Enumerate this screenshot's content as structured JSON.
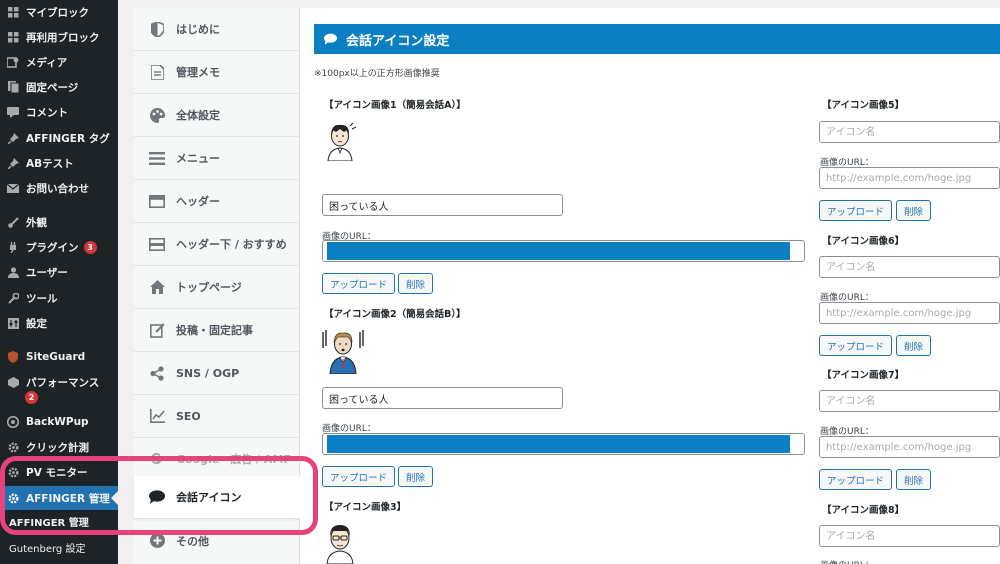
{
  "wp_sidebar": {
    "items": [
      {
        "label": "マイブロック",
        "icon": "grid-icon"
      },
      {
        "label": "再利用ブロック",
        "icon": "grid-icon"
      },
      {
        "label": "メディア",
        "icon": "media-icon"
      },
      {
        "label": "固定ページ",
        "icon": "page-icon"
      },
      {
        "label": "コメント",
        "icon": "comment-icon"
      },
      {
        "label": "AFFINGER タグ",
        "icon": "pin-icon"
      },
      {
        "label": "ABテスト",
        "icon": "pin-icon"
      },
      {
        "label": "お問い合わせ",
        "icon": "mail-icon"
      },
      {
        "label": "外観",
        "icon": "brush-icon"
      },
      {
        "label": "プラグイン",
        "icon": "plugin-icon",
        "badge": "3"
      },
      {
        "label": "ユーザー",
        "icon": "user-icon"
      },
      {
        "label": "ツール",
        "icon": "wrench-icon"
      },
      {
        "label": "設定",
        "icon": "settings-icon"
      },
      {
        "label": "SiteGuard",
        "icon": "shield-icon"
      },
      {
        "label": "パフォーマンス",
        "icon": "performance-icon",
        "badge": "2"
      },
      {
        "label": "BackWPup",
        "icon": "backup-icon"
      },
      {
        "label": "クリック計測",
        "icon": "gear-icon"
      },
      {
        "label": "PV モニター",
        "icon": "gear-icon"
      },
      {
        "label": "AFFINGER 管理",
        "icon": "gear-icon"
      }
    ],
    "submenu_partial": "AFFINGER 管理",
    "submenu_gutenberg": "Gutenberg 設定"
  },
  "settings_menu": {
    "items": [
      {
        "label": "はじめに",
        "icon": "shield-half-icon"
      },
      {
        "label": "管理メモ",
        "icon": "memo-icon"
      },
      {
        "label": "全体設定",
        "icon": "palette-icon"
      },
      {
        "label": "メニュー",
        "icon": "hamburger-icon"
      },
      {
        "label": "ヘッダー",
        "icon": "header-icon"
      },
      {
        "label": "ヘッダー下 / おすすめ",
        "icon": "header-below-icon"
      },
      {
        "label": "トップページ",
        "icon": "home-icon"
      },
      {
        "label": "投稿・固定記事",
        "icon": "edit-icon"
      },
      {
        "label": "SNS / OGP",
        "icon": "share-icon"
      },
      {
        "label": "SEO",
        "icon": "chart-line-icon"
      },
      {
        "label": "Google・広告 / AMP",
        "icon": "google-icon"
      },
      {
        "label": "会話アイコン",
        "icon": "speech-bubble-icon"
      },
      {
        "label": "その他",
        "icon": "plus-circle-icon"
      }
    ],
    "active_label": "会話アイコン"
  },
  "panel": {
    "title": "会話アイコン設定",
    "note": "※100px以上の正方形画像推奨",
    "url_label": "画像のURL：",
    "upload_label": "アップロード",
    "delete_label": "削除",
    "name_placeholder": "アイコン名",
    "url_placeholder": "http://example.com/hoge.jpg",
    "left_icons": [
      {
        "label": "【アイコン画像1（簡易会話A）】",
        "name": "困っている人"
      },
      {
        "label": "【アイコン画像2（簡易会話B）】",
        "name": "困っている人"
      },
      {
        "label": "【アイコン画像3】"
      }
    ],
    "right_icons": [
      {
        "label": "【アイコン画像5】"
      },
      {
        "label": "【アイコン画像6】"
      },
      {
        "label": "【アイコン画像7】"
      },
      {
        "label": "【アイコン画像8】"
      }
    ]
  },
  "colors": {
    "wp_sidebar_bg": "#1d2327",
    "wp_active": "#2271b1",
    "header_blue": "#0b7fc2",
    "highlight_pink": "#e6437c"
  }
}
